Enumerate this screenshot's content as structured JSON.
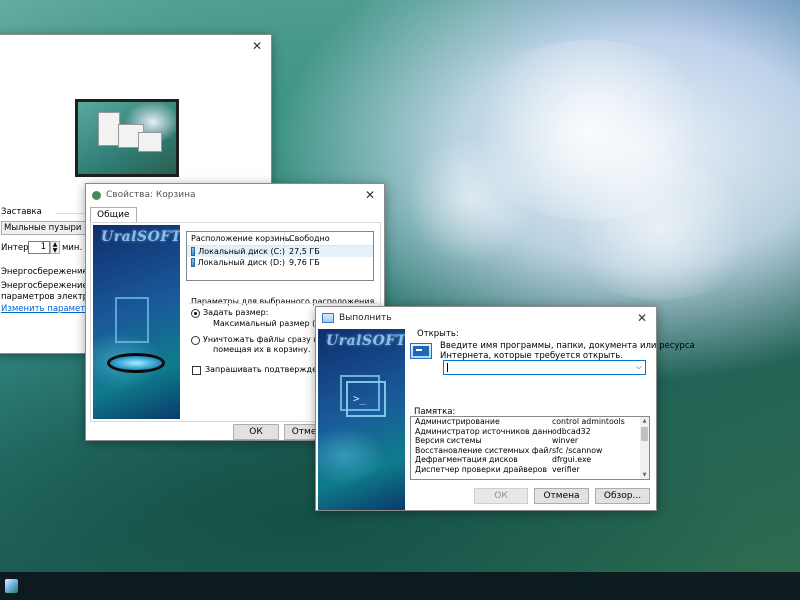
{
  "screensaver_window": {
    "group_label": "Заставка",
    "selected_saver": "Мыльные пузыри",
    "interval_prefix": "Интер",
    "interval_value": "1",
    "interval_unit": "мин.",
    "power_heading": "Энергосбережение",
    "power_line1": "Энергосбережение за сч",
    "power_line2": "параметров электропит",
    "power_link": "Изменить параметры эл"
  },
  "recycle_window": {
    "title": "Свойства: Корзина",
    "tab_label": "Общие",
    "logo_text": "UralSOFT",
    "columns": [
      "Расположение корзины",
      "Свободно"
    ],
    "rows": [
      {
        "name": "Локальный диск (C:)",
        "free": "27,5 ГБ"
      },
      {
        "name": "Локальный диск (D:)",
        "free": "9,76 ГБ"
      }
    ],
    "params_heading": "Параметры для выбранного расположения",
    "custom_size_label": "Задать размер:",
    "max_size_label": "Максимальный размер (МБ):",
    "delete_immediately_line1": "Уничтожать файлы сразу после уд",
    "delete_immediately_line2": "помещая их в корзину.",
    "confirm_label": "Запрашивать подтверждение на уд",
    "ok_label": "ОК",
    "cancel_label": "Отмен"
  },
  "run_window": {
    "title": "Выполнить",
    "logo_text": "UralSOFT",
    "prompt_line1": "Введите имя программы, папки, документа или ресурса",
    "prompt_line2": "Интернета, которые требуется открыть.",
    "open_label": "Открыть:",
    "open_value": "",
    "memo_label": "Памятка:",
    "memo": [
      {
        "name": "Администрирование",
        "cmd": "control admintools"
      },
      {
        "name": "Администратор источников данных",
        "cmd": "odbcad32"
      },
      {
        "name": "Версия системы",
        "cmd": "winver"
      },
      {
        "name": "Восстановление системных файлов",
        "cmd": "sfc /scannow"
      },
      {
        "name": "Дефрагментация дисков",
        "cmd": "dfrgui.exe"
      },
      {
        "name": "Диспетчер проверки драйверов",
        "cmd": "verifier"
      }
    ],
    "ok_label": "ОК",
    "cancel_label": "Отмена",
    "browse_label": "Обзор..."
  },
  "icons": {
    "close": "close-icon",
    "start": "windows-start-icon",
    "run": "run-icon"
  },
  "colors": {
    "accent": "#0078d7",
    "link": "#0066cc",
    "banner_dark": "#0f2e6e"
  }
}
